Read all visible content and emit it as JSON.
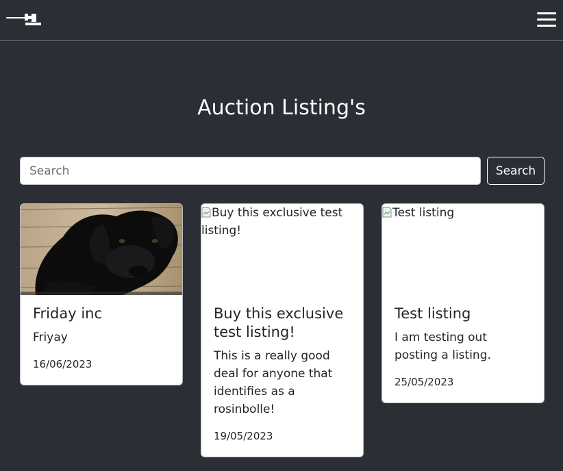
{
  "nav": {
    "logo_icon": "gavel-icon",
    "menu_icon": "hamburger-menu-icon"
  },
  "page": {
    "title": "Auction Listing's"
  },
  "search": {
    "placeholder": "Search",
    "value": "",
    "button_label": "Search"
  },
  "listings": [
    {
      "image_alt": "",
      "image": "black-puppy-photo",
      "title": "Friday inc",
      "description": "Friyay",
      "date": "16/06/2023"
    },
    {
      "image_alt": "Buy this exclusive test listing!",
      "title": "Buy this exclusive test listing!",
      "description": "This is a really good deal for anyone that identifies as a rosinbolle!",
      "date": "19/05/2023"
    },
    {
      "image_alt": "Test listing",
      "title": "Test listing",
      "description": "I am testing out posting a listing.",
      "date": "25/05/2023"
    }
  ],
  "colors": {
    "background": "#2b2f35",
    "card_background": "#ffffff",
    "text_dark": "#212529"
  }
}
